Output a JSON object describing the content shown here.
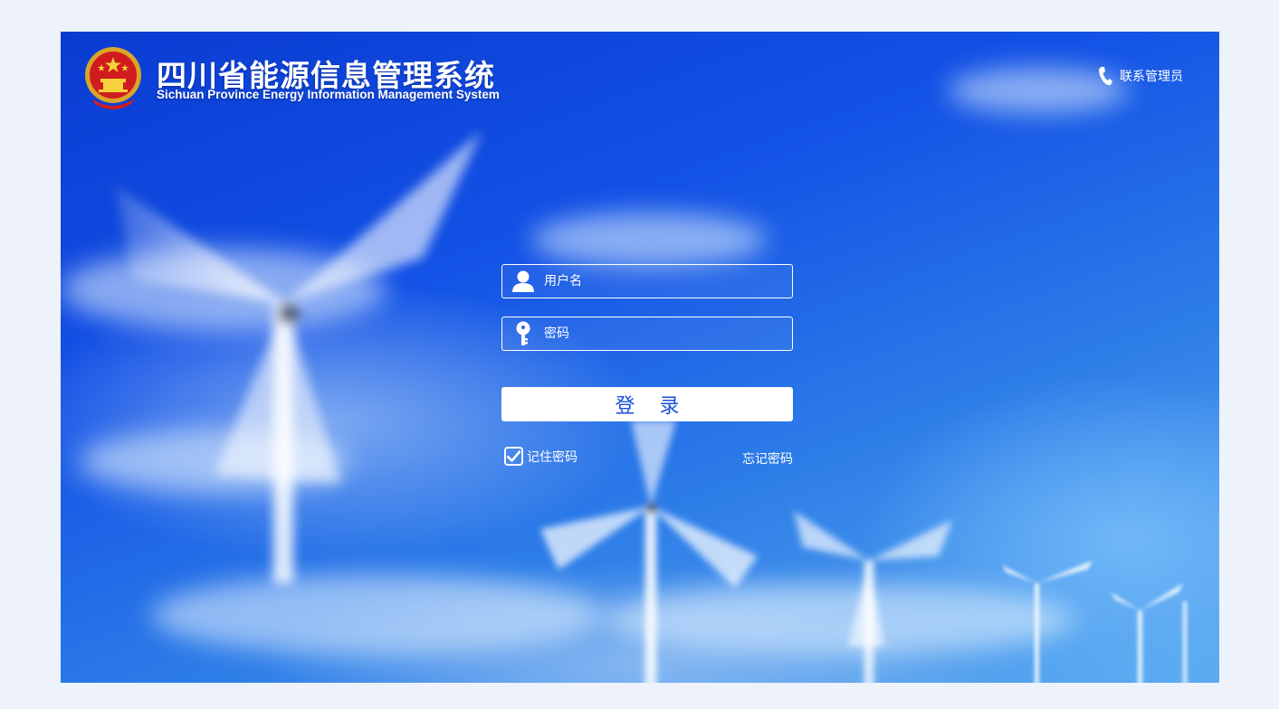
{
  "header": {
    "title_cn": "四川省能源信息管理系统",
    "title_en": "Sichuan Province Energy Information Management System",
    "contact_label": "联系管理员",
    "logo_icon": "national-emblem-icon",
    "contact_icon": "phone-icon"
  },
  "login": {
    "username_placeholder": "用户名",
    "password_placeholder": "密码",
    "submit_label": "登 录",
    "remember_label": "记住密码",
    "remember_checked": true,
    "forgot_label": "忘记密码"
  },
  "colors": {
    "page_background": "#edf2fb",
    "sky_top": "#0a3bd1",
    "sky_bottom": "#5aaaf0",
    "button_text": "#1a4fd6"
  }
}
